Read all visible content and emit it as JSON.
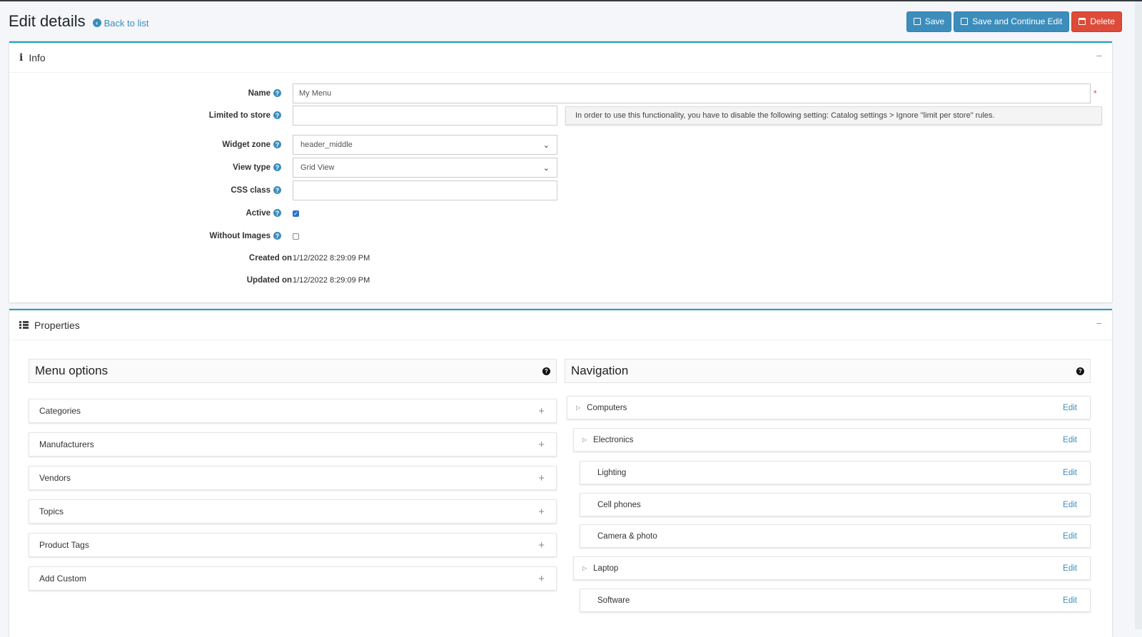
{
  "header": {
    "title": "Edit details",
    "back_label": "Back to list",
    "buttons": {
      "save": "Save",
      "save_continue": "Save and Continue Edit",
      "delete": "Delete"
    }
  },
  "info": {
    "title": "Info",
    "collapse": "−",
    "fields": {
      "name_label": "Name",
      "name_value": "My Menu",
      "required_mark": "*",
      "limited_label": "Limited to store",
      "limited_hint": "In order to use this functionality, you have to disable the following setting: Catalog settings > Ignore \"limit per store\" rules.",
      "widget_label": "Widget zone",
      "widget_value": "header_middle",
      "view_label": "View type",
      "view_value": "Grid View",
      "css_label": "CSS class",
      "css_value": "",
      "active_label": "Active",
      "active_checked": true,
      "without_images_label": "Without Images",
      "without_images_checked": false,
      "created_label": "Created on",
      "created_value": "1/12/2022 8:29:09 PM",
      "updated_label": "Updated on",
      "updated_value": "1/12/2022 8:29:09 PM"
    }
  },
  "properties": {
    "title": "Properties",
    "collapse": "−",
    "menu_options": {
      "title": "Menu options",
      "items": [
        "Categories",
        "Manufacturers",
        "Vendors",
        "Topics",
        "Product Tags",
        "Add Custom"
      ]
    },
    "navigation": {
      "title": "Navigation",
      "edit_label": "Edit",
      "items": [
        "Computers",
        "Electronics",
        "Lighting",
        "Cell phones",
        "Camera & photo",
        "Laptop",
        "Software"
      ]
    }
  },
  "colors": {
    "accent": "#3c8dbc",
    "danger": "#dd4b39",
    "card_border": "#17a2b8"
  },
  "icons": [
    "back-arrow-icon",
    "save-icon",
    "trash-icon",
    "info-icon",
    "list-icon",
    "help-icon",
    "plus-icon",
    "expand-triangle-icon"
  ]
}
